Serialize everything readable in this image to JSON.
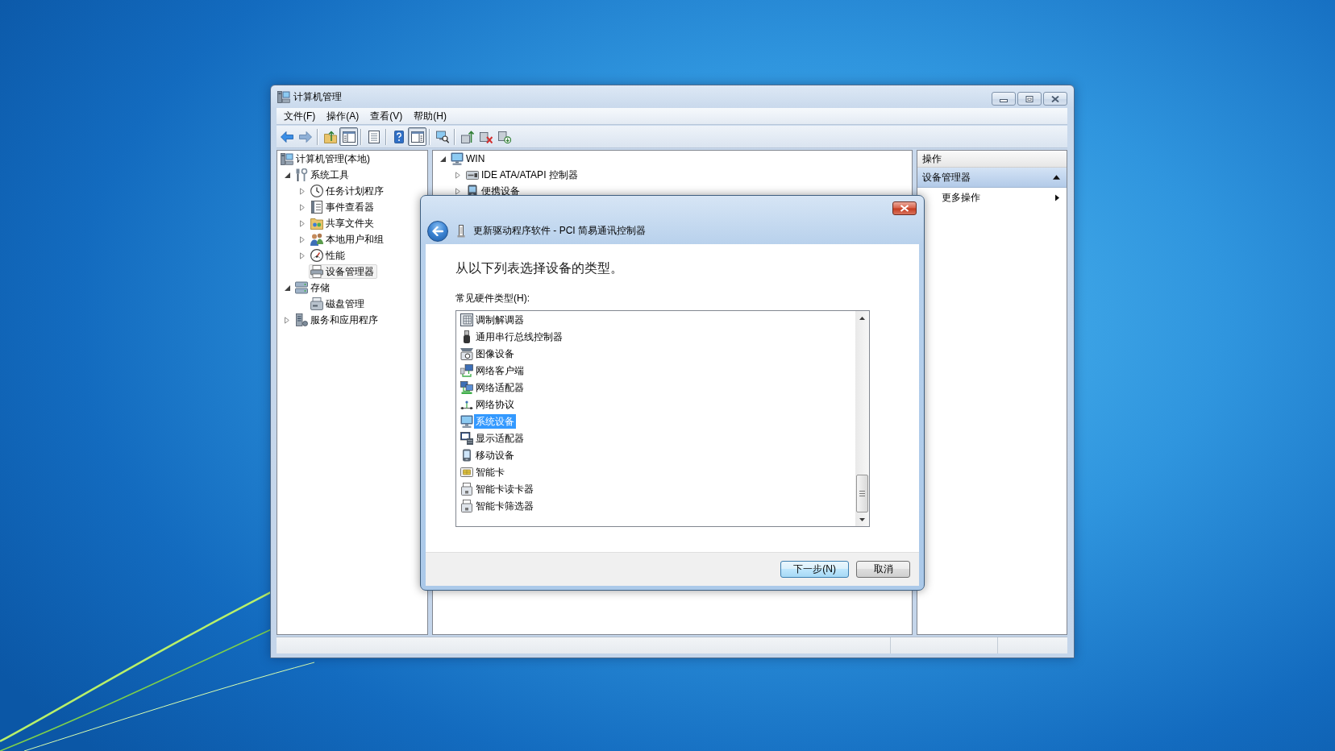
{
  "window": {
    "title": "计算机管理"
  },
  "menu": [
    "文件(F)",
    "操作(A)",
    "查看(V)",
    "帮助(H)"
  ],
  "toolbar": [
    [
      {
        "pressed": false
      },
      {
        "pressed": false
      }
    ],
    [
      {
        "pressed": false
      },
      {
        "pressed": true
      }
    ],
    [
      {
        "pressed": false
      }
    ],
    [
      {
        "pressed": false
      },
      {
        "pressed": true
      }
    ],
    [
      {
        "pressed": false
      }
    ],
    [
      {
        "pressed": false
      },
      {
        "pressed": false
      },
      {
        "pressed": false
      }
    ]
  ],
  "console_tree": [
    {
      "label": "计算机管理(本地)",
      "selected": false,
      "children": [
        {
          "label": "系统工具",
          "expanded": true,
          "selected": false,
          "children": [
            {
              "label": "任务计划程序",
              "expanded": false,
              "selected": false
            },
            {
              "label": "事件查看器",
              "expanded": false,
              "selected": false
            },
            {
              "label": "共享文件夹",
              "expanded": false,
              "selected": false
            },
            {
              "label": "本地用户和组",
              "expanded": false,
              "selected": false
            },
            {
              "label": "性能",
              "expanded": false,
              "selected": false
            },
            {
              "label": "设备管理器",
              "selected": true
            }
          ]
        },
        {
          "label": "存储",
          "expanded": true,
          "selected": false,
          "children": [
            {
              "label": "磁盘管理",
              "selected": false
            }
          ]
        },
        {
          "label": "服务和应用程序",
          "expanded": false,
          "selected": false
        }
      ]
    }
  ],
  "device_tree": [
    {
      "label": "WIN",
      "expanded": true,
      "selected": false,
      "children": [
        {
          "label": "IDE ATA/ATAPI 控制器",
          "expanded": false,
          "selected": false
        },
        {
          "label": "便携设备",
          "expanded": false,
          "selected": false
        }
      ]
    }
  ],
  "actions": {
    "header": "操作",
    "sections": [
      {
        "title": "设备管理器",
        "expanded": true,
        "items": [
          {
            "label": "更多操作",
            "submenu": true
          }
        ]
      }
    ]
  },
  "dialog": {
    "title": "更新驱动程序软件 - PCI 简易通讯控制器",
    "heading": "从以下列表选择设备的类型。",
    "list_label": "常见硬件类型(H):",
    "hardware_types": [
      {
        "label": "调制解调器",
        "selected": false
      },
      {
        "label": "通用串行总线控制器",
        "selected": false
      },
      {
        "label": "图像设备",
        "selected": false
      },
      {
        "label": "网络客户端",
        "selected": false
      },
      {
        "label": "网络适配器",
        "selected": false
      },
      {
        "label": "网络协议",
        "selected": false
      },
      {
        "label": "系统设备",
        "selected": true
      },
      {
        "label": "显示适配器",
        "selected": false
      },
      {
        "label": "移动设备",
        "selected": false
      },
      {
        "label": "智能卡",
        "selected": false
      },
      {
        "label": "智能卡读卡器",
        "selected": false
      },
      {
        "label": "智能卡筛选器",
        "selected": false
      }
    ],
    "buttons": [
      {
        "label": "下一步(N)",
        "default": true
      },
      {
        "label": "取消",
        "default": false
      }
    ]
  }
}
